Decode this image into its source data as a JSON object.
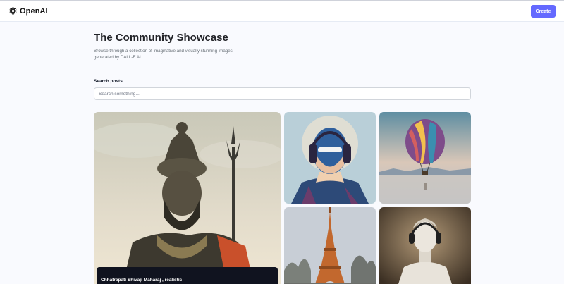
{
  "header": {
    "brand": "OpenAI",
    "logo_icon": "openai-logo-icon",
    "create_label": "Create",
    "accent_color": "#6469ff"
  },
  "main": {
    "title": "The Community Showcase",
    "subtitle": "Browse through a collection of imaginative and visually stunning images generated by DALL-E AI",
    "search": {
      "label": "Search posts",
      "placeholder": "Search something...",
      "value": ""
    }
  },
  "gallery": [
    {
      "caption": "Chhatrapati Shivaji Maharaj , realistic",
      "subject": "warrior-statue-image"
    },
    {
      "subject": "superhero-headphones-image"
    },
    {
      "subject": "hot-air-balloon-image"
    },
    {
      "subject": "eiffel-tower-image"
    },
    {
      "subject": "statue-headphones-image"
    }
  ]
}
